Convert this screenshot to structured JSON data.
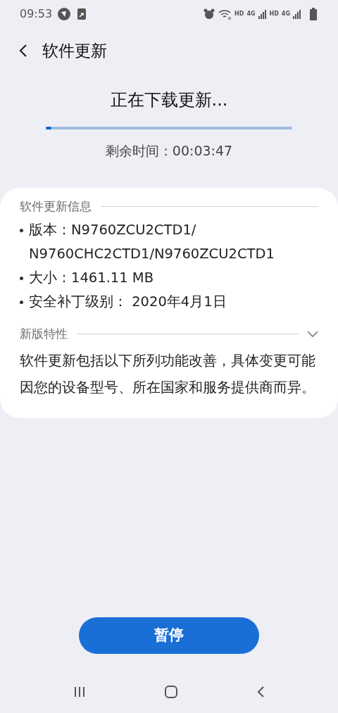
{
  "status_bar": {
    "time": "09:53",
    "network_labels": [
      "HD",
      "4G",
      "HD",
      "4G"
    ]
  },
  "header": {
    "title": "软件更新"
  },
  "download": {
    "heading": "正在下载更新...",
    "level": 0.015,
    "remaining": "剩余时间：00:03:47"
  },
  "info_section": {
    "title": "软件更新信息",
    "items": [
      {
        "text": "版本：N9760ZCU2CTD1/ N9760CHC2CTD1/N9760ZCU2CTD1"
      },
      {
        "text": "大小：1461.11 MB"
      },
      {
        "text": "安全补丁级别： 2020年4月1日"
      }
    ]
  },
  "features_section": {
    "title": "新版特性",
    "expanded": false,
    "description": "软件更新包括以下所列功能改善，具体变更可能因您的设备型号、所在国家和服务提供商而异。"
  },
  "pause_button": {
    "label": "暂停"
  }
}
